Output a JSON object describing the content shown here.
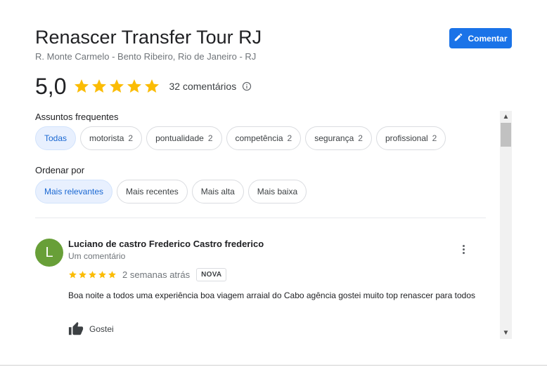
{
  "place": {
    "name": "Renascer Transfer Tour RJ",
    "address": "R. Monte Carmelo - Bento Ribeiro, Rio de Janeiro - RJ"
  },
  "actions": {
    "comment_label": "Comentar"
  },
  "rating": {
    "value": "5,0",
    "stars": 5,
    "review_count_label": "32 comentários"
  },
  "topics": {
    "label": "Assuntos frequentes",
    "chips": [
      {
        "label": "Todas",
        "count": "",
        "selected": true
      },
      {
        "label": "motorista",
        "count": "2",
        "selected": false
      },
      {
        "label": "pontualidade",
        "count": "2",
        "selected": false
      },
      {
        "label": "competência",
        "count": "2",
        "selected": false
      },
      {
        "label": "segurança",
        "count": "2",
        "selected": false
      },
      {
        "label": "profissional",
        "count": "2",
        "selected": false
      }
    ]
  },
  "sort": {
    "label": "Ordenar por",
    "options": [
      {
        "label": "Mais relevantes",
        "selected": true
      },
      {
        "label": "Mais recentes",
        "selected": false
      },
      {
        "label": "Mais alta",
        "selected": false
      },
      {
        "label": "Mais baixa",
        "selected": false
      }
    ]
  },
  "review": {
    "avatar_letter": "L",
    "avatar_color": "#689f38",
    "author": "Luciano de castro Frederico Castro frederico",
    "author_meta": "Um comentário",
    "stars": 5,
    "time": "2 semanas atrás",
    "badge": "NOVA",
    "text": "Boa noite a todos uma experiência boa viagem arraial do Cabo agência gostei muito top renascer para todos",
    "like_label": "Gostei"
  },
  "colors": {
    "star": "#fbbc04",
    "accent": "#1a73e8",
    "selected_chip_text": "#1967d2"
  }
}
